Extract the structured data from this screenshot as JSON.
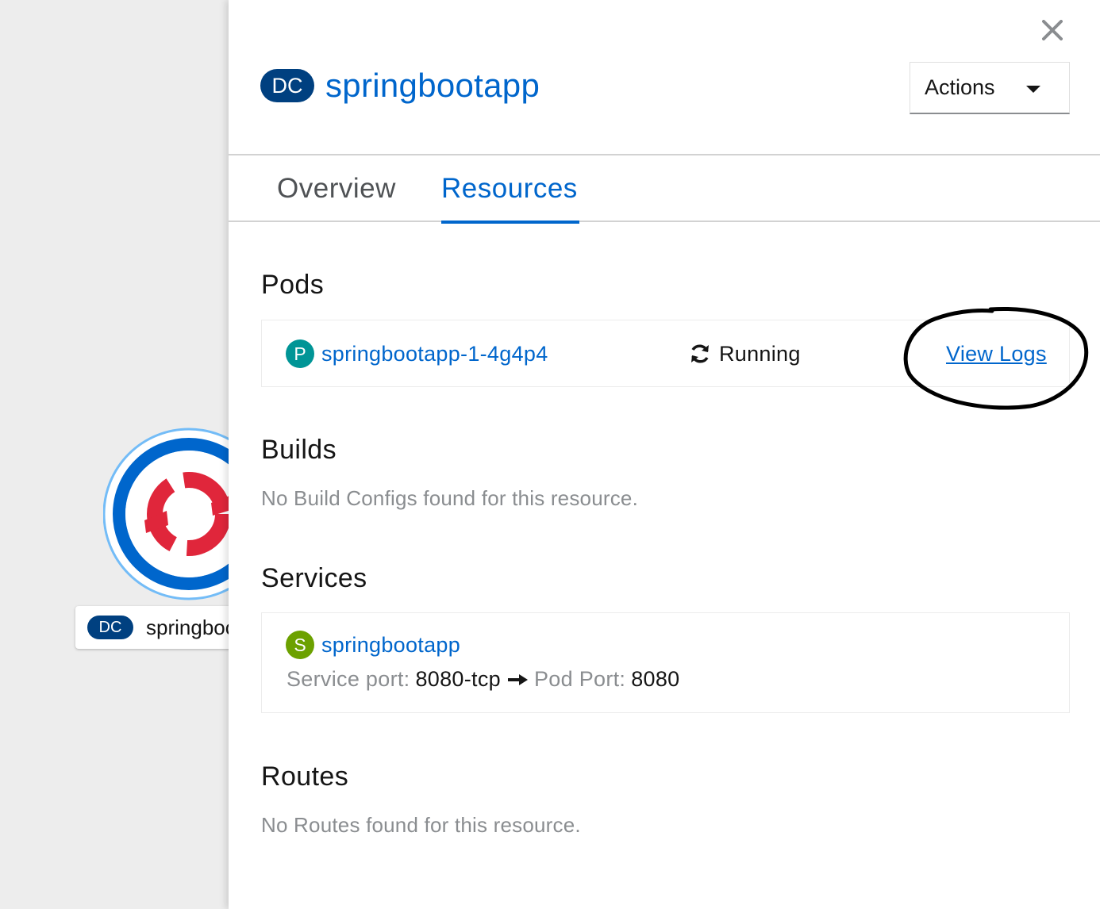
{
  "topology": {
    "node_badge": "DC",
    "node_name": "springbootapp",
    "colors": {
      "ring_outer": "#73bcf7",
      "ring_inner": "#0066cc",
      "logo": "#e0263b"
    }
  },
  "panel": {
    "close_icon": "close-icon",
    "badge": "DC",
    "title": "springbootapp",
    "actions_label": "Actions",
    "tabs": [
      {
        "label": "Overview",
        "active": false
      },
      {
        "label": "Resources",
        "active": true
      }
    ]
  },
  "pods": {
    "title": "Pods",
    "items": [
      {
        "badge": "P",
        "name": "springbootapp-1-4g4p4",
        "status": "Running",
        "logs_label": "View Logs"
      }
    ]
  },
  "builds": {
    "title": "Builds",
    "empty": "No Build Configs found for this resource."
  },
  "services": {
    "title": "Services",
    "items": [
      {
        "badge": "S",
        "name": "springbootapp",
        "service_port_label": "Service port:",
        "service_port": "8080-tcp",
        "pod_port_label": "Pod Port:",
        "pod_port": "8080"
      }
    ]
  },
  "routes": {
    "title": "Routes",
    "empty": "No Routes found for this resource."
  },
  "colors": {
    "link": "#0066cc",
    "dc_badge": "#004080",
    "pod_badge": "#009596",
    "service_badge": "#6ca100",
    "muted_text": "#8a8d90"
  }
}
